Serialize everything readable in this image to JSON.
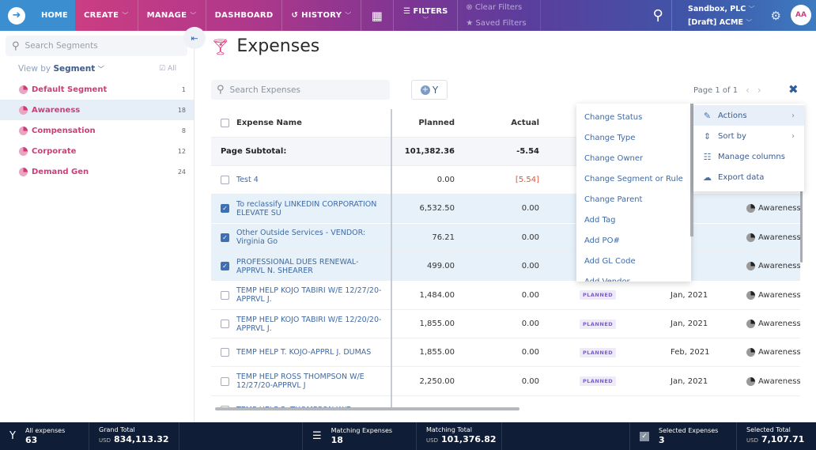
{
  "nav": {
    "home": "HOME",
    "create": "CREATE",
    "manage": "MANAGE",
    "dashboard": "DASHBOARD",
    "history": "HISTORY",
    "filters": "FILTERS",
    "clear_filters": "Clear Filters",
    "saved_filters": "Saved Filters",
    "org": "Sandbox, PLC",
    "plan": "[Draft] ACME",
    "avatar": "AA"
  },
  "sidebar": {
    "search_placeholder": "Search Segments",
    "view_by_label": "View by",
    "view_by_value": "Segment",
    "all_label": "All",
    "segments": [
      {
        "label": "Default Segment",
        "count": "1"
      },
      {
        "label": "Awareness",
        "count": "18"
      },
      {
        "label": "Compensation",
        "count": "8"
      },
      {
        "label": "Corporate",
        "count": "12"
      },
      {
        "label": "Demand Gen",
        "count": "24"
      }
    ]
  },
  "main": {
    "title": "Expenses",
    "search_placeholder": "Search Expenses",
    "pager": "Page 1 of 1",
    "columns": {
      "name": "Expense Name",
      "planned": "Planned",
      "actual": "Actual"
    },
    "subtotal": {
      "label": "Page Subtotal:",
      "planned": "101,382.36",
      "actual": "-5.54"
    },
    "rows": [
      {
        "name": "Test 4",
        "planned": "0.00",
        "actual": "[5.54]",
        "status": "",
        "date": "",
        "segment": ""
      },
      {
        "name": "To reclassify LINKEDIN CORPORATION ELEVATE SU",
        "planned": "6,532.50",
        "actual": "0.00",
        "status": "",
        "date": "021",
        "segment": "Awareness"
      },
      {
        "name": "Other Outside Services - VENDOR: Virginia Go",
        "planned": "76.21",
        "actual": "0.00",
        "status": "",
        "date": "021",
        "segment": "Awareness"
      },
      {
        "name": "PROFESSIONAL DUES RENEWAL-APPRVL N. SHEARER",
        "planned": "499.00",
        "actual": "0.00",
        "status": "",
        "date": "021",
        "segment": "Awareness"
      },
      {
        "name": "TEMP HELP KOJO TABIRI W/E 12/27/20-APPRVL J.",
        "planned": "1,484.00",
        "actual": "0.00",
        "status": "PLANNED",
        "date": "Jan, 2021",
        "segment": "Awareness"
      },
      {
        "name": "TEMP HELP KOJO TABIRI W/E 12/20/20-APPRVL J.",
        "planned": "1,855.00",
        "actual": "0.00",
        "status": "PLANNED",
        "date": "Jan, 2021",
        "segment": "Awareness"
      },
      {
        "name": "TEMP HELP T. KOJO-APPRL J. DUMAS",
        "planned": "1,855.00",
        "actual": "0.00",
        "status": "PLANNED",
        "date": "Feb, 2021",
        "segment": "Awareness"
      },
      {
        "name": "TEMP HELP ROSS THOMPSON W/E 12/27/20-APPRVL J",
        "planned": "2,250.00",
        "actual": "0.00",
        "status": "PLANNED",
        "date": "Jan, 2021",
        "segment": "Awareness"
      },
      {
        "name": "TEMP HELP R. THOMPSON W/E",
        "planned": "",
        "actual": "",
        "status": "",
        "date": "",
        "segment": ""
      }
    ]
  },
  "actions_menu": [
    "Change Status",
    "Change Type",
    "Change Owner",
    "Change Segment or Rule",
    "Change Parent",
    "Add Tag",
    "Add PO#",
    "Add GL Code",
    "Add Vendor"
  ],
  "tools_menu": [
    {
      "label": "Actions",
      "icon": "pencil-ruler-icon",
      "submenu": true
    },
    {
      "label": "Sort by",
      "icon": "sort-icon",
      "submenu": true
    },
    {
      "label": "Manage columns",
      "icon": "columns-icon",
      "submenu": false
    },
    {
      "label": "Export data",
      "icon": "cloud-download-icon",
      "submenu": false
    }
  ],
  "footer": {
    "all_label": "All expenses",
    "all_value": "63",
    "grand_label": "Grand Total",
    "grand_currency": "USD",
    "grand_value": "834,113.32",
    "matching_label": "Matching Expenses",
    "matching_value": "18",
    "matching_total_label": "Matching Total",
    "matching_total_currency": "USD",
    "matching_total_value": "101,376.82",
    "selected_label": "Selected Expenses",
    "selected_value": "3",
    "selected_total_label": "Selected Total",
    "selected_total_currency": "USD",
    "selected_total_value": "7,107.71"
  }
}
